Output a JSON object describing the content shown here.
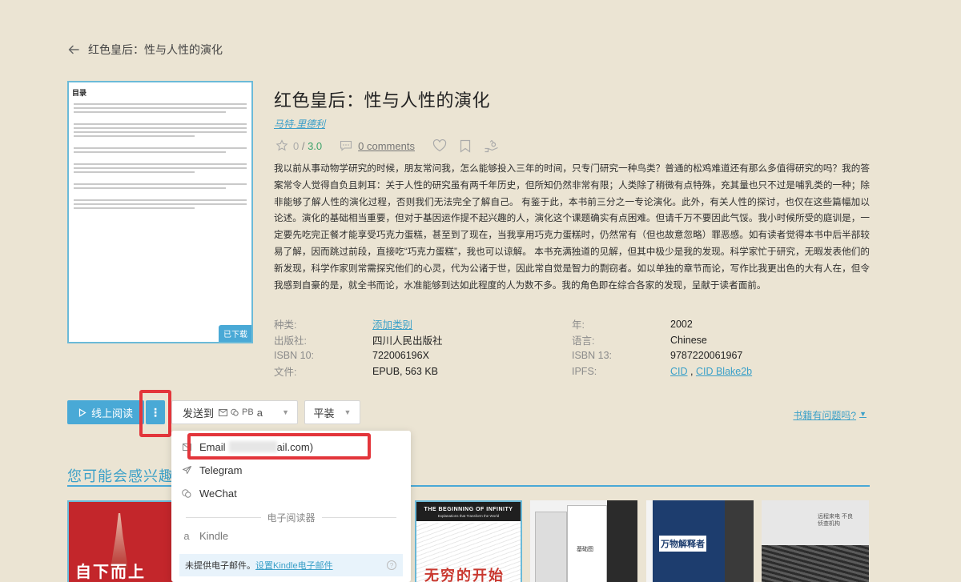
{
  "header": {
    "back_title": "红色皇后：性与人性的演化"
  },
  "cover": {
    "title_text": "目录",
    "badge": "已下载"
  },
  "book": {
    "title": "红色皇后：性与人性的演化",
    "author": "马特·里德利",
    "rating_value": "0",
    "rating_sep": " / ",
    "rating_score": "3.0",
    "comments": "0 comments",
    "description": "我以前从事动物学研究的时候，朋友常问我，怎么能够投入三年的时间，只专门研究一种鸟类？普通的松鸡难道还有那么多值得研究的吗？我的答案常令人觉得自负且刺耳：关于人性的研究虽有两千年历史，但所知仍然非常有限；人类除了稍微有点特殊，充其量也只不过是哺乳类的一种；除非能够了解人性的演化过程，否则我们无法完全了解自己。 有鉴于此，本书前三分之一专论演化。此外，有关人性的探讨，也仅在这些篇幅加以论述。演化的基础相当重要，但对于基因运作提不起兴趣的人，演化这个课题确实有点困难。但请千万不要因此气馁。我小时候所受的庭训是，一定要先吃完正餐才能享受巧克力蛋糕，甚至到了现在，当我享用巧克力蛋糕时，仍然常有（但也故意忽略）罪恶感。如有读者觉得本书中后半部较易了解，因而跳过前段，直接吃“巧克力蛋糕”，我也可以谅解。 本书充满独道的见解，但其中极少是我的发现。科学家忙于研究，无暇发表他们的新发现，科学作家则常需探究他们的心灵，代为公诸于世，因此常自觉是智力的剽窃者。如以单独的章节而论，写作比我更出色的大有人在，但令我感到自豪的是，就全书而论，水准能够到达如此程度的人为数不多。我的角色即在综合各家的发现，呈献于读者面前。"
  },
  "props_left": [
    {
      "key": "种类:",
      "value": "添加类别",
      "link": true
    },
    {
      "key": "出版社:",
      "value": "四川人民出版社",
      "link": false
    },
    {
      "key": "ISBN 10:",
      "value": "722006196X",
      "link": false
    },
    {
      "key": "文件:",
      "value": "EPUB, 563 KB",
      "link": false
    }
  ],
  "props_right": [
    {
      "key": "年:",
      "value": "2002"
    },
    {
      "key": "语言:",
      "value": "Chinese"
    },
    {
      "key": "ISBN 13:",
      "value": "9787220061967"
    },
    {
      "key": "IPFS:",
      "cid": "CID",
      "sep": " , ",
      "cid2": "CID Blake2b"
    }
  ],
  "actions": {
    "read_online": "线上阅读",
    "more": "⋮",
    "send_to": "发送到",
    "send_pb": "PB",
    "format": "平装",
    "report": "书籍有问题吗?"
  },
  "dropdown": {
    "email_label": "Email",
    "email_suffix": "ail.com)",
    "telegram": "Telegram",
    "wechat": "WeChat",
    "ereader_header": "电子阅读器",
    "kindle": "Kindle",
    "note_text": "未提供电子邮件。",
    "note_link": "设置Kindle电子邮件"
  },
  "related": {
    "title": "您可能会感兴趣",
    "books": [
      {
        "title": "自下而上"
      },
      {
        "title": "THE BEGINNING OF INFINITY",
        "subtitle": "Explanations that Transform the World",
        "cn": "无穷的开始"
      },
      {
        "title": "基础图"
      },
      {
        "title": "万物解释者"
      },
      {
        "title": "远程来电 不良侦查机构"
      }
    ]
  },
  "colors": {
    "accent": "#49a9d6",
    "highlight": "#e3353b",
    "background": "#ebe4d3"
  }
}
